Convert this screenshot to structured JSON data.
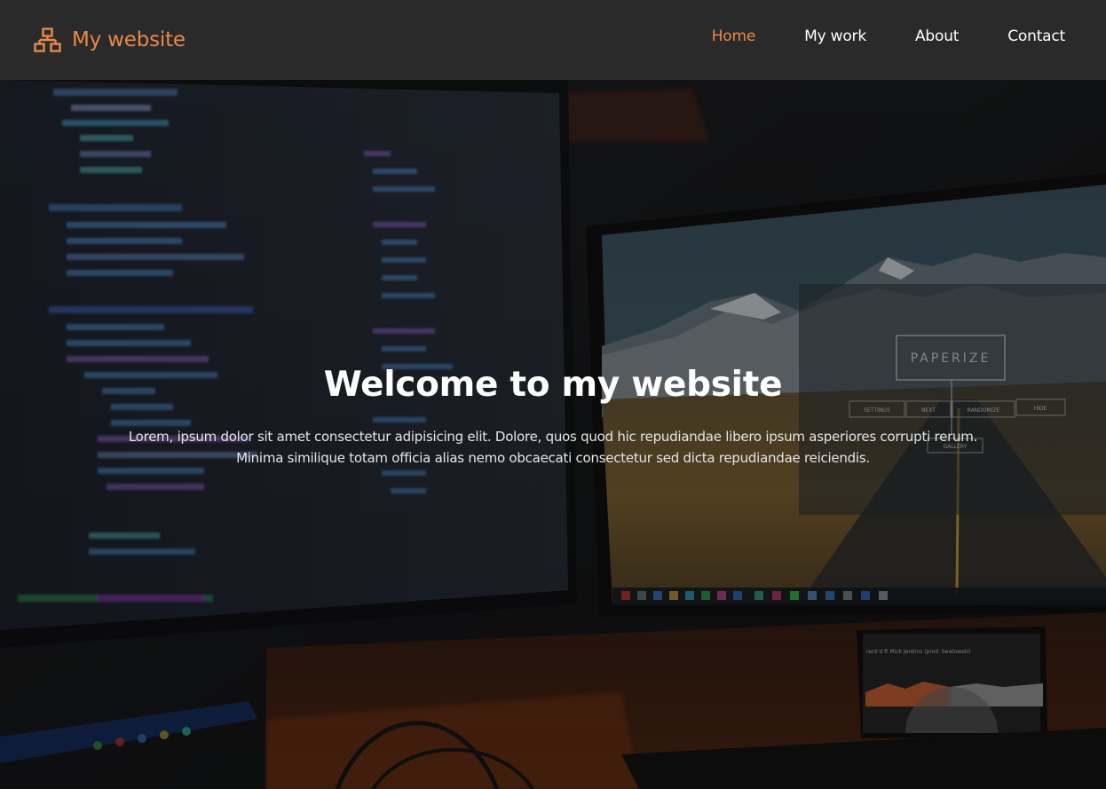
{
  "navbar": {
    "brand": {
      "icon": "sitemap-icon",
      "label": "My website"
    },
    "links": [
      {
        "label": "Home",
        "active": true
      },
      {
        "label": "My work",
        "active": false
      },
      {
        "label": "About",
        "active": false
      },
      {
        "label": "Contact",
        "active": false
      }
    ]
  },
  "hero": {
    "title": "Welcome to my website",
    "text": "Lorem, ipsum dolor sit amet consectetur adipisicing elit. Dolore, quos quod hic repudiandae libero ipsum asperiores corrupti rerum. Minima similique totam officia alias nemo obcaecati consectetur sed dicta repudiandae reiciendis.",
    "background": {
      "description_icon": "dual-monitor-desk-photo",
      "monitor_label": "PAPERIZE",
      "monitor_buttons": [
        "SETTINGS",
        "NEXT",
        "RANDOMIZE",
        "HIDE"
      ],
      "monitor_sub_button": "GALLERY",
      "phone_track": "reck'd ft Mick Jenkins (prod. beatowski)"
    }
  },
  "colors": {
    "accent": "#e8894a",
    "navbar_bg": "#2a2a2a",
    "text": "#ffffff"
  }
}
